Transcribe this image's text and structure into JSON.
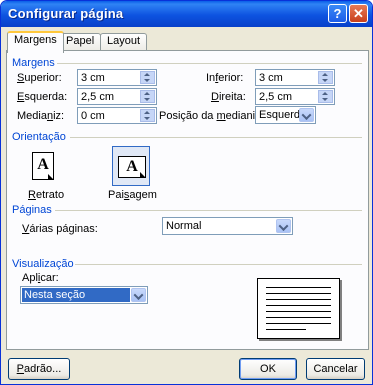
{
  "dialog": {
    "title": "Configurar página",
    "help_glyph": "?",
    "close_glyph": "✕"
  },
  "tabs": [
    {
      "label": "Margens",
      "active": true
    },
    {
      "label": "Papel",
      "active": false
    },
    {
      "label": "Layout",
      "active": false
    }
  ],
  "margins": {
    "heading": "Margens",
    "superior": {
      "label_pre": "",
      "label_u": "S",
      "label_post": "uperior:",
      "value": "3 cm"
    },
    "inferior": {
      "label_pre": "In",
      "label_u": "f",
      "label_post": "erior:",
      "value": "3 cm"
    },
    "esquerda": {
      "label_pre": "",
      "label_u": "E",
      "label_post": "squerda:",
      "value": "2,5 cm"
    },
    "direita": {
      "label_pre": "",
      "label_u": "D",
      "label_post": "ireita:",
      "value": "2,5 cm"
    },
    "medianiz": {
      "label_pre": "Media",
      "label_u": "n",
      "label_post": "iz:",
      "value": "0 cm"
    },
    "posicao_medianiz": {
      "label_pre": "Posição da ",
      "label_u": "m",
      "label_post": "edianiz:",
      "value": "Esquerda"
    }
  },
  "orientation": {
    "heading": "Orientação",
    "retrato": {
      "label_pre": "",
      "label_u": "R",
      "label_post": "etrato",
      "glyph": "A",
      "selected": false
    },
    "paisagem": {
      "label_pre": "Pai",
      "label_u": "s",
      "label_post": "agem",
      "glyph": "A",
      "selected": true
    }
  },
  "pages": {
    "heading": "Páginas",
    "label_pre": "",
    "label_u": "V",
    "label_post": "árias páginas:",
    "value": "Normal"
  },
  "preview": {
    "heading": "Visualização",
    "apply_pre": "Apl",
    "apply_u": "i",
    "apply_post": "car:",
    "apply_value": "Nesta seção"
  },
  "buttons": {
    "default_pre": "",
    "default_u": "P",
    "default_post": "adrão...",
    "ok": "OK",
    "cancel": "Cancelar"
  },
  "colors": {
    "title_bar": "#0a5ee8",
    "group_heading": "#0046d5",
    "selection": "#316ac5"
  }
}
